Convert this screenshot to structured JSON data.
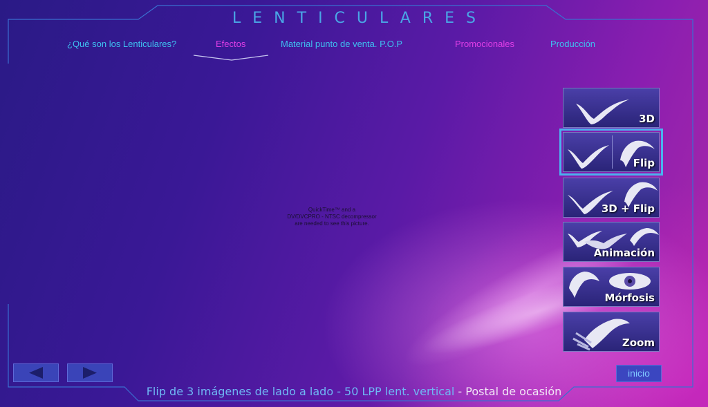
{
  "header": {
    "title": "LENTICULARES"
  },
  "nav": [
    {
      "label": "¿Qué son los Lenticulares?",
      "color": "#3fc0f0"
    },
    {
      "label": "Efectos",
      "color": "#e03ee6",
      "active": true
    },
    {
      "label": "Material punto de venta.  P.O.P",
      "color": "#3fc0f0"
    },
    {
      "label": "Promocionales",
      "color": "#e03ee6"
    },
    {
      "label": "Producción",
      "color": "#3fc0f0"
    }
  ],
  "effects": [
    {
      "label": "3D",
      "icon": "bird-icon"
    },
    {
      "label": "Flip",
      "icon": "bird-flip-icon",
      "selected": true
    },
    {
      "label": "3D + Flip",
      "icon": "bird-3d-flip-icon"
    },
    {
      "label": "Animación",
      "icon": "bird-flock-icon"
    },
    {
      "label": "Mórfosis",
      "icon": "bird-eye-morph-icon"
    },
    {
      "label": "Zoom",
      "icon": "bird-zoom-icon"
    }
  ],
  "video_placeholder": {
    "lines": [
      "QuickTime™ and a",
      "DV/DVCPRO - NTSC decompressor",
      "are needed to see this picture."
    ]
  },
  "footer": {
    "prev_icon": "arrow-left-icon",
    "next_icon": "arrow-right-icon",
    "home_label": "inicio",
    "caption_main": "Flip de 3 imágenes de lado a lado - 50 LPP lent. vertical",
    "caption_sep": " - ",
    "caption_tail": "Postal de ocasión"
  },
  "colors": {
    "accent": "#4ab2ee",
    "frame": "#3a6fd0",
    "nav_blue": "#3fc0f0",
    "nav_pink": "#e03ee6"
  }
}
